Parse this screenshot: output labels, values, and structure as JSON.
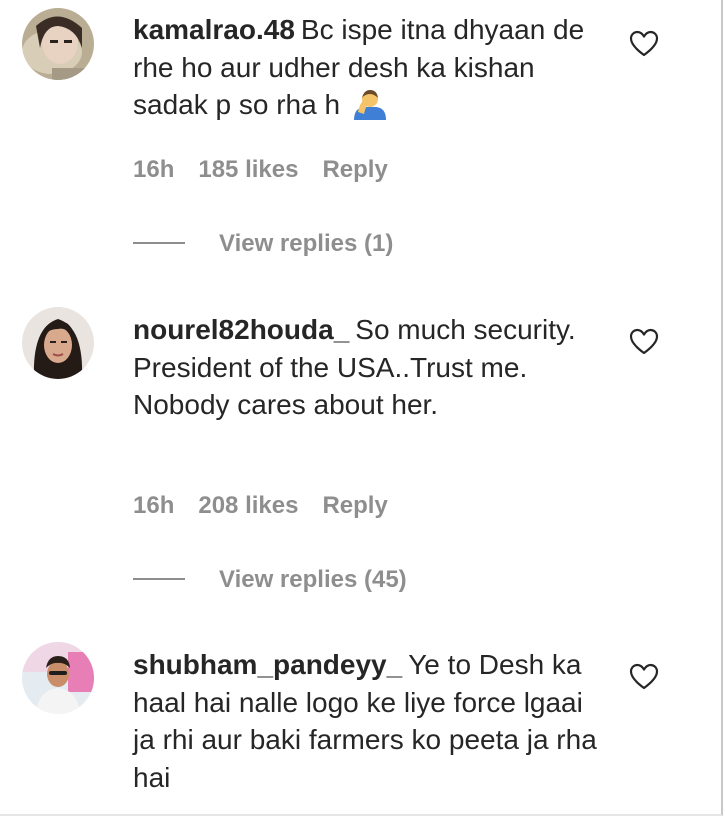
{
  "comments": [
    {
      "username": "kamalrao.48",
      "text": "Bc ispe itna dhyaan de rhe ho aur udher desh ka kishan sadak p so rha h",
      "emoji": "person-facepalming-emoji",
      "time": "16h",
      "likes": "185 likes",
      "reply": "Reply",
      "view_replies": "View replies (1)"
    },
    {
      "username": "nourel82houda_",
      "text": "So much security. President of the USA..Trust me. Nobody cares about her.",
      "time": "16h",
      "likes": "208 likes",
      "reply": "Reply",
      "view_replies": "View replies (45)"
    },
    {
      "username": "shubham_pandeyy_",
      "text": "Ye to Desh ka haal hai nalle logo ke liye force lgaai ja rhi aur baki farmers ko peeta ja rha hai"
    }
  ],
  "colors": {
    "text": "#262626",
    "muted": "#8e8e8e",
    "background": "#ffffff"
  }
}
